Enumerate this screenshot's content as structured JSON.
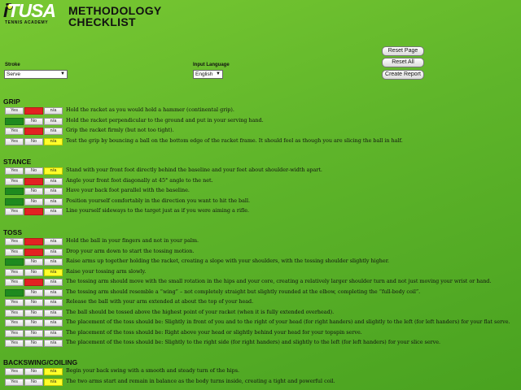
{
  "logo": {
    "brand": "iTUSA",
    "subtitle": "TENNIS ACADEMY"
  },
  "title": {
    "line1": "METHODOLOGY",
    "line2": "CHECKLIST"
  },
  "toolbar": {
    "reset_page": "Reset Page",
    "reset_all": "Reset All",
    "create_report": "Create Report"
  },
  "stroke": {
    "label": "Stroke",
    "value": "Serve"
  },
  "language": {
    "label": "Input Language",
    "value": "English"
  },
  "buttons": {
    "yes": "Yes",
    "no": "No",
    "na": "n/a"
  },
  "colors": {
    "yes_selected": "#1f8a1f",
    "no_selected": "#e22222",
    "na_selected": "#ffff2a"
  },
  "sections": [
    {
      "title": "GRIP",
      "items": [
        {
          "text": "Hold the racket as you would hold a hammer (continental grip).",
          "selected": "no"
        },
        {
          "text": "Hold the racket perpendicular to the ground and put in your serving hand.",
          "selected": "yes"
        },
        {
          "text": "Grip the racket firmly (but not too tight).",
          "selected": "no"
        },
        {
          "text": "Test the grip by bouncing a ball on the bottom edge of the racket frame. It should feel as though you are slicing the ball in half.",
          "selected": "na"
        }
      ]
    },
    {
      "title": "STANCE",
      "items": [
        {
          "text": "Stand with your front foot directly behind the baseline and your feet about shoulder-width apart.",
          "selected": "na"
        },
        {
          "text": "Angle your front foot diagonally at 45° angle to the net.",
          "selected": "no"
        },
        {
          "text": "Have your back foot parallel with the baseline.",
          "selected": "yes"
        },
        {
          "text": "Position yourself comfortably in the direction you want to hit the ball.",
          "selected": "yes"
        },
        {
          "text": "Line yourself sideways to the target just as if you were aiming a rifle.",
          "selected": "no"
        }
      ]
    },
    {
      "title": "TOSS",
      "items": [
        {
          "text": "Hold the ball in your fingers and not in your palm.",
          "selected": "no"
        },
        {
          "text": "Drop your arm down to start the tossing motion.",
          "selected": "no"
        },
        {
          "text": "Raise arms up together holding the racket, creating a slope with your shoulders, with the tossing shoulder slightly higher.",
          "selected": "yes"
        },
        {
          "text": "Raise your tossing arm slowly.",
          "selected": "na"
        },
        {
          "text": "The tossing arm should move with the small rotation in the hips and your core, creating a relatively larger shoulder turn and not just moving your wrist or hand.",
          "selected": "no"
        },
        {
          "text": "The tossing arm should resemble a “wing” – not completely straight but slightly rounded at the elbow, completing the “full-body coil”.",
          "selected": "yes"
        },
        {
          "text": "Release the ball with your arm extended at about the top of your head.",
          "selected": "none"
        },
        {
          "text": "The ball should be tossed above the highest point of your racket (when it is fully extended overhead).",
          "selected": "none"
        },
        {
          "text": "The placement of the toss should be: Slightly in front of you and to the right of your head (for right handers) and slightly to the left (for left handers) for your flat serve.",
          "selected": "none"
        },
        {
          "text": "The placement of the toss should be: Right above your head or slightly behind your head for your topspin serve.",
          "selected": "none"
        },
        {
          "text": "The placement of the toss should be: Slightly to the right side (for right handers) and slightly to the left (for left handers) for your slice serve.",
          "selected": "none"
        }
      ]
    },
    {
      "title": "BACKSWING/COILING",
      "items": [
        {
          "text": "Begin your back swing with a smooth and steady turn of the hips.",
          "selected": "na"
        },
        {
          "text": "The two arms start and remain in balance as the body turns inside, creating a tight and powerful coil.",
          "selected": "na"
        }
      ]
    }
  ]
}
